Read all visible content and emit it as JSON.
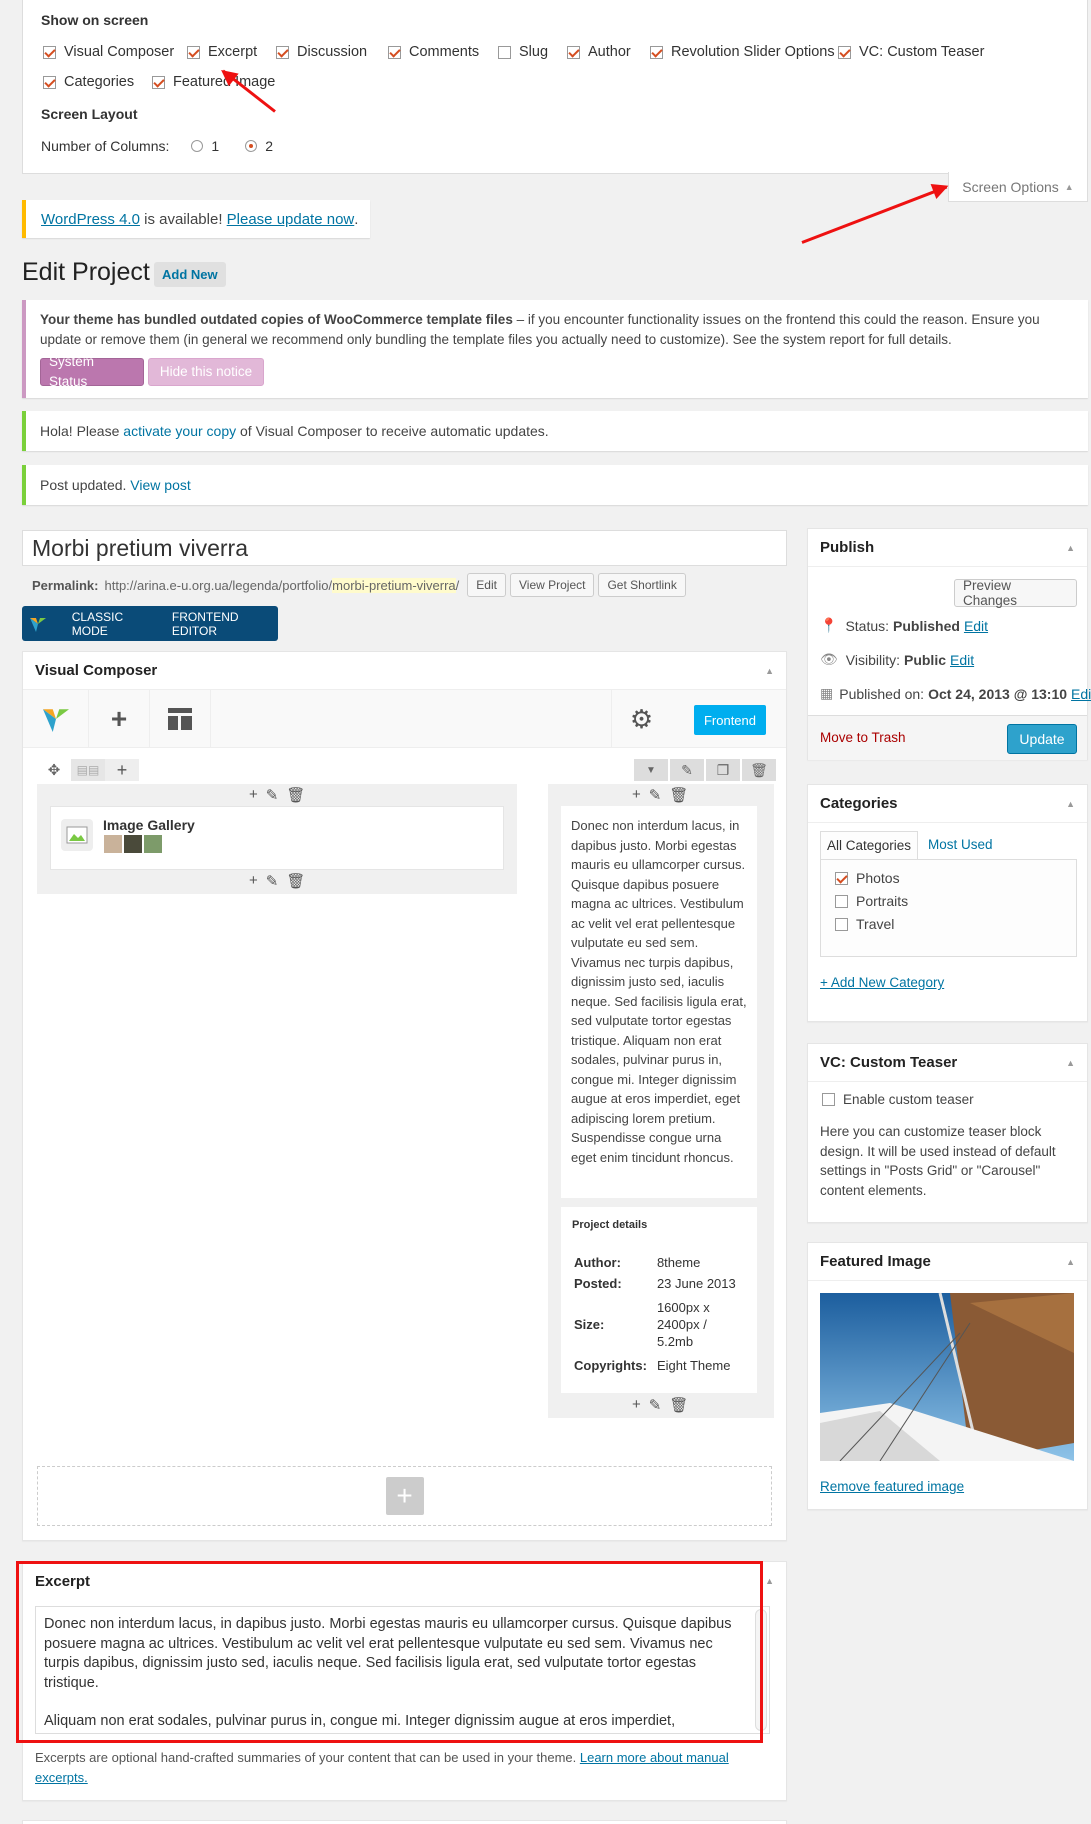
{
  "screen_options": {
    "show_title": "Show on screen",
    "items": [
      {
        "label": "Visual Composer",
        "checked": true
      },
      {
        "label": "Excerpt",
        "checked": true
      },
      {
        "label": "Discussion",
        "checked": true
      },
      {
        "label": "Comments",
        "checked": true
      },
      {
        "label": "Slug",
        "checked": false
      },
      {
        "label": "Author",
        "checked": true
      },
      {
        "label": "Revolution Slider Options",
        "checked": true
      },
      {
        "label": "VC: Custom Teaser",
        "checked": true
      },
      {
        "label": "Categories",
        "checked": true
      },
      {
        "label": "Featured Image",
        "checked": true
      }
    ],
    "layout_title": "Screen Layout",
    "columns_label": "Number of Columns:",
    "col1": "1",
    "col2": "2",
    "tab_label": "Screen Options"
  },
  "update_notice": {
    "link": "WordPress 4.0",
    "middle": " is available! ",
    "update_link": "Please update now",
    "end": "."
  },
  "page": {
    "title": "Edit Project",
    "add_new": "Add New"
  },
  "woo_notice": {
    "bold": "Your theme has bundled outdated copies of WooCommerce template files",
    "text": " – if you encounter functionality issues on the frontend this could the reason. Ensure you update or remove them (in general we recommend only bundling the template files you actually need to customize). See the system report for full details.",
    "btn1": "System Status",
    "btn2": "Hide this notice"
  },
  "vc_notice": {
    "pre": "Hola! Please ",
    "link": "activate your copy",
    "post": " of Visual Composer to receive automatic updates."
  },
  "post_notice": {
    "text": "Post updated. ",
    "link": "View post"
  },
  "post": {
    "title": "Morbi pretium viverra",
    "permalink_label": "Permalink:",
    "permalink_base": "http://arina.e-u.org.ua/legenda/portfolio/",
    "permalink_slug": "morbi-pretium-viverra",
    "permalink_end": "/",
    "edit_btn": "Edit",
    "view_btn": "View Project",
    "shortlink_btn": "Get Shortlink"
  },
  "vc_modes": {
    "classic": "CLASSIC MODE",
    "frontend": "FRONTEND EDITOR"
  },
  "vc": {
    "title": "Visual Composer",
    "frontend_btn": "Frontend",
    "gallery_label": "Image Gallery",
    "text_block": "Donec non interdum lacus, in dapibus justo. Morbi egestas mauris eu ullamcorper cursus. Quisque dapibus posuere magna ac ultrices. Vestibulum ac velit vel erat pellentesque vulputate eu sed sem. Vivamus nec turpis dapibus, dignissim justo sed, iaculis neque. Sed facilisis ligula erat, sed vulputate tortor egestas tristique. Aliquam non erat sodales, pulvinar purus in, congue mi. Integer dignissim augue at eros imperdiet, eget adipiscing lorem pretium. Suspendisse congue urna eget enim tincidunt rhoncus.",
    "details_title": "Project details",
    "details": [
      {
        "k": "Author:",
        "v": "8theme"
      },
      {
        "k": "Posted:",
        "v": "23 June 2013"
      },
      {
        "k": "Size:",
        "v": "1600px x 2400px / 5.2mb"
      },
      {
        "k": "Copyrights:",
        "v": "Eight Theme"
      }
    ]
  },
  "excerpt": {
    "title": "Excerpt",
    "para1": "Donec non interdum lacus, in dapibus justo. Morbi egestas mauris eu ullamcorper cursus. Quisque dapibus posuere magna ac ultrices. Vestibulum ac velit vel erat pellentesque vulputate eu sed sem. Vivamus nec turpis dapibus, dignissim justo sed, iaculis neque. Sed facilisis ligula erat, sed vulputate tortor egestas tristique.",
    "para2": "Aliquam non erat sodales, pulvinar purus in, congue mi. Integer dignissim augue at eros imperdiet,",
    "help": "Excerpts are optional hand-crafted summaries of your content that can be used in your theme. ",
    "help_link": "Learn more about manual excerpts."
  },
  "publish": {
    "title": "Publish",
    "preview": "Preview Changes",
    "status_label": "Status:",
    "status": "Published",
    "visibility_label": "Visibility:",
    "visibility": "Public",
    "published_label": "Published on:",
    "published": "Oct 24, 2013 @ 13:10",
    "edit": "Edit",
    "trash": "Move to Trash",
    "update": "Update"
  },
  "categories": {
    "title": "Categories",
    "tab_all": "All Categories",
    "tab_used": "Most Used",
    "items": [
      {
        "label": "Photos",
        "checked": true
      },
      {
        "label": "Portraits",
        "checked": false
      },
      {
        "label": "Travel",
        "checked": false
      }
    ],
    "add": "+ Add New Category"
  },
  "teaser": {
    "title": "VC: Custom Teaser",
    "enable": "Enable custom teaser",
    "desc": "Here you can customize teaser block design. It will be used instead of default settings in \"Posts Grid\" or \"Carousel\" content elements."
  },
  "featured": {
    "title": "Featured Image",
    "remove": "Remove featured image"
  },
  "colors": {
    "accent": "#0074a2",
    "highlight": "#e11111",
    "vc_blue": "#0a4b78",
    "update_blue": "#2ea2cc"
  }
}
